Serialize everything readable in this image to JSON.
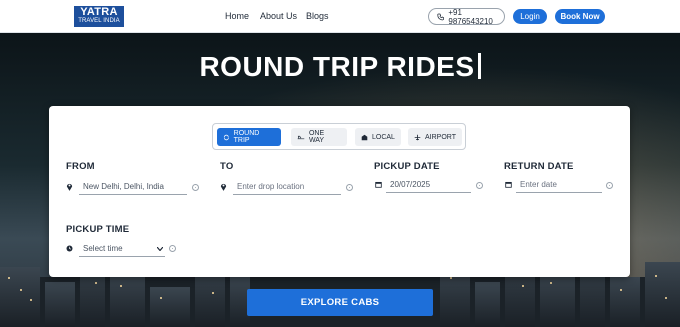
{
  "header": {
    "logo_line1": "YATRA",
    "logo_line2": "TRAVEL INDIA",
    "nav": [
      "Home",
      "About Us",
      "Blogs"
    ],
    "phone": "+91 9876543210",
    "login": "Login",
    "book_now": "Book Now"
  },
  "hero": {
    "title": "ROUND TRIP RIDES"
  },
  "tabs": [
    {
      "label": "ROUND TRIP",
      "icon": "round-trip-icon",
      "active": true
    },
    {
      "label": "ONE WAY",
      "icon": "plane-icon",
      "active": false
    },
    {
      "label": "LOCAL",
      "icon": "local-icon",
      "active": false
    },
    {
      "label": "AIRPORT",
      "icon": "airport-icon",
      "active": false
    }
  ],
  "form": {
    "from_label": "FROM",
    "from_value": "New Delhi, Delhi, India",
    "to_label": "TO",
    "to_placeholder": "Enter drop location",
    "pickup_date_label": "PICKUP DATE",
    "pickup_date_value": "20/07/2025",
    "return_date_label": "RETURN DATE",
    "return_date_placeholder": "Enter date",
    "pickup_time_label": "PICKUP TIME",
    "pickup_time_value": "Select time"
  },
  "explore": "EXPLORE CABS",
  "colors": {
    "primary": "#1e6fd9",
    "logo_bg": "#1d4f9c"
  }
}
